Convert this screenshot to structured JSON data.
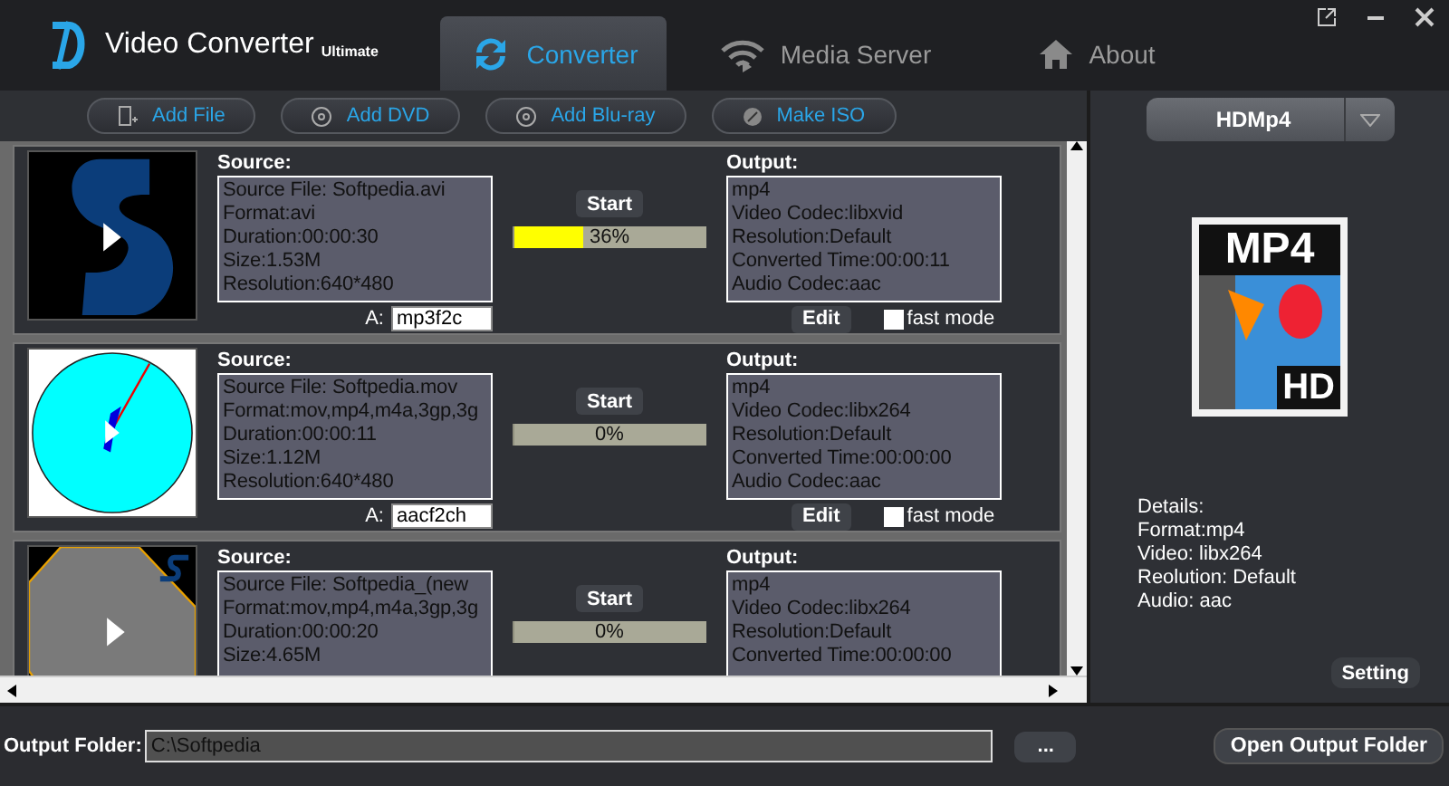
{
  "app": {
    "title": "Video Converter",
    "edition": "Ultimate"
  },
  "tabs": [
    {
      "label": "Converter",
      "kind": "converter",
      "selected": true
    },
    {
      "label": "Media Server",
      "kind": "server",
      "selected": false
    },
    {
      "label": "About",
      "kind": "about",
      "selected": false
    }
  ],
  "toolbar": [
    {
      "label": "Add File",
      "kind": "file"
    },
    {
      "label": "Add DVD",
      "kind": "disc"
    },
    {
      "label": "Add Blu-ray",
      "kind": "disc"
    },
    {
      "label": "Make ISO",
      "kind": "iso"
    }
  ],
  "items": [
    {
      "kind": "logo",
      "source_label": "Source:",
      "source_lines": [
        "Source File: Softpedia.avi",
        "Format:avi",
        "Duration:00:00:30",
        "Size:1.53M",
        "Resolution:640*480"
      ],
      "start": "Start",
      "level": 0.36,
      "reading": "36%",
      "output_label": "Output:",
      "output_lines": [
        "mp4",
        "Video Codec:libxvid",
        "Resolution:Default",
        "Converted Time:00:00:11",
        "Audio Codec:aac"
      ],
      "audio_label": "A:",
      "audio_track": "mp3f2c",
      "edit": "Edit",
      "fast_mode": {
        "label": "fast mode",
        "checked": false
      }
    },
    {
      "kind": "clock",
      "source_label": "Source:",
      "source_lines": [
        "Source File: Softpedia.mov",
        "Format:mov,mp4,m4a,3gp,3g",
        "Duration:00:00:11",
        "Size:1.12M",
        "Resolution:640*480"
      ],
      "start": "Start",
      "level": 0,
      "reading": "0%",
      "output_label": "Output:",
      "output_lines": [
        "mp4",
        "Video Codec:libx264",
        "Resolution:Default",
        "Converted Time:00:00:00",
        "Audio Codec:aac"
      ],
      "audio_label": "A:",
      "audio_track": "aacf2ch",
      "edit": "Edit",
      "fast_mode": {
        "label": "fast mode",
        "checked": false
      }
    },
    {
      "kind": "octagon",
      "source_label": "Source:",
      "source_lines": [
        "Source File: Softpedia_(new",
        "Format:mov,mp4,m4a,3gp,3g",
        "Duration:00:00:20",
        "Size:4.65M"
      ],
      "start": "Start",
      "level": 0,
      "reading": "0%",
      "output_label": "Output:",
      "output_lines": [
        "mp4",
        "Video Codec:libx264",
        "Resolution:Default",
        "Converted Time:00:00:00"
      ]
    }
  ],
  "profile": {
    "name": "HDMp4",
    "badge_format": "MP4",
    "badge_quality": "HD",
    "details": [
      "Details:",
      "Format:mp4",
      "Video: libx264",
      "Reolution: Default",
      "Audio: aac"
    ],
    "setting": "Setting"
  },
  "footer": {
    "label": "Output Folder:",
    "value": "C:\\Softpedia",
    "browse": "...",
    "open": "Open Output Folder"
  }
}
